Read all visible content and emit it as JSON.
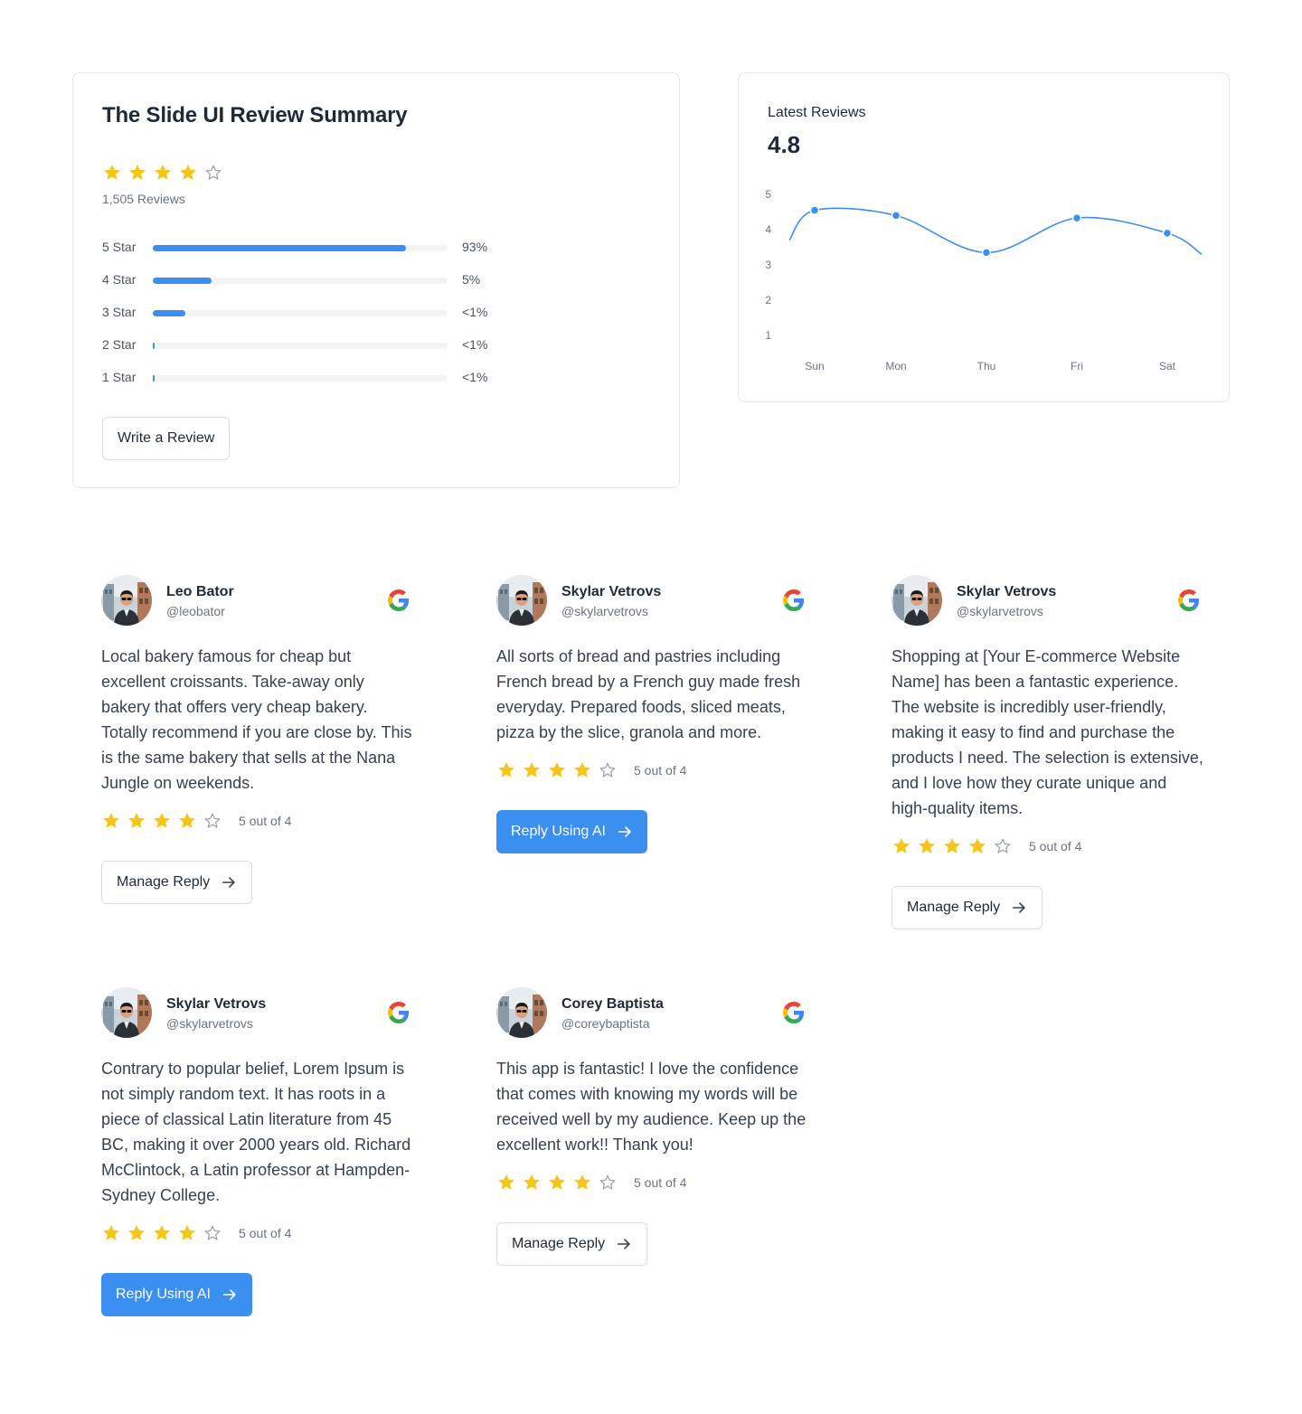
{
  "summary": {
    "title": "The Slide UI Review Summary",
    "rating_stars": 4,
    "max_stars": 5,
    "reviews_count": "1,505 Reviews",
    "distribution": [
      {
        "label": "5 Star",
        "percent_text": "93%",
        "fill": 0.86
      },
      {
        "label": "4 Star",
        "percent_text": "5%",
        "fill": 0.2
      },
      {
        "label": "3 Star",
        "percent_text": "<1%",
        "fill": 0.11
      },
      {
        "label": "2 Star",
        "percent_text": "<1%",
        "fill": 0.006
      },
      {
        "label": "1 Star",
        "percent_text": "<1%",
        "fill": 0.006
      }
    ],
    "write_review_label": "Write a Review"
  },
  "latest": {
    "title": "Latest Reviews",
    "value": "4.8"
  },
  "chart_data": {
    "type": "line",
    "title": "Latest Reviews",
    "x": [
      "Sun",
      "Mon",
      "Thu",
      "Fri",
      "Sat"
    ],
    "series": [
      {
        "values": [
          4.55,
          4.4,
          3.35,
          4.33,
          3.9
        ]
      }
    ],
    "ylim": [
      1,
      5
    ],
    "yticks": [
      5,
      4,
      3,
      2,
      1
    ],
    "grid": false,
    "color": "#3b8ff0"
  },
  "colors": {
    "accent": "#3b8ff0",
    "star": "#f5c518",
    "star_empty": "#9ca3af"
  },
  "reviews": [
    {
      "name": "Leo Bator",
      "handle": "@leobator",
      "text": "Local bakery famous for cheap but excellent croissants. Take-away only bakery that offers very cheap bakery. Totally recommend if you are close by. This is the same bakery that sells at the Nana Jungle on weekends.",
      "stars": 4,
      "rating_text": "5 out of 4",
      "button_label": "Manage Reply",
      "button_type": "outline"
    },
    {
      "name": "Skylar Vetrovs",
      "handle": "@skylarvetrovs",
      "text": "All sorts of bread and pastries including French bread by a French guy made fresh everyday. Prepared foods, sliced meats, pizza by the slice, granola and more.",
      "stars": 4,
      "rating_text": "5 out of 4",
      "button_label": "Reply Using AI",
      "button_type": "primary"
    },
    {
      "name": "Skylar Vetrovs",
      "handle": "@skylarvetrovs",
      "text": "Shopping at [Your E-commerce Website Name] has been a fantastic experience. The website is incredibly user-friendly, making it easy to find and purchase the products I need. The selection is extensive, and I love how they curate unique and high-quality items.",
      "stars": 4,
      "rating_text": "5 out of 4",
      "button_label": "Manage Reply",
      "button_type": "outline"
    },
    {
      "name": "Skylar Vetrovs",
      "handle": "@skylarvetrovs",
      "text": "Contrary to popular belief, Lorem Ipsum is not simply random text. It has roots in a piece of classical Latin literature from 45 BC, making it over 2000 years old. Richard McClintock, a Latin professor at Hampden-Sydney College.",
      "stars": 4,
      "rating_text": "5 out of 4",
      "button_label": "Reply Using AI",
      "button_type": "primary"
    },
    {
      "name": "Corey Baptista",
      "handle": "@coreybaptista",
      "text": "This app is fantastic! I love the confidence that comes with knowing my words will be received well by my audience. Keep up the excellent work!! Thank you!",
      "stars": 4,
      "rating_text": "5 out of 4",
      "button_label": "Manage Reply",
      "button_type": "outline"
    }
  ]
}
